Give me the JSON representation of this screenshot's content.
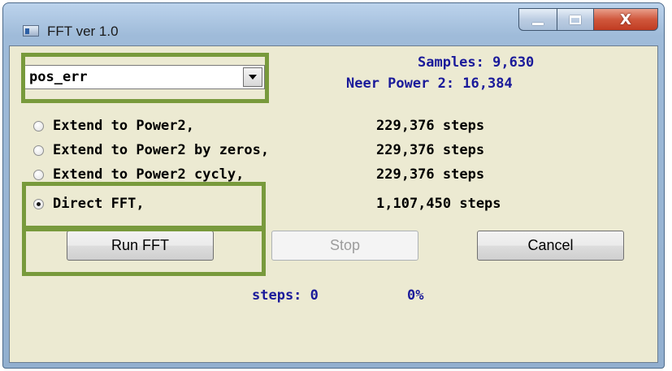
{
  "window": {
    "title": "FFT ver 1.0"
  },
  "title_buttons": {
    "minimize": "minimize",
    "maximize": "maximize",
    "close": "X"
  },
  "signal_select": {
    "value": "pos_err"
  },
  "info": {
    "samples": "Samples: 9,630",
    "near_power2": "Neer Power 2: 16,384"
  },
  "options": [
    {
      "label": "Extend to Power2,",
      "steps": "229,376 steps",
      "checked": false
    },
    {
      "label": "Extend to Power2 by zeros,",
      "steps": "229,376 steps",
      "checked": false
    },
    {
      "label": "Extend to Power2 cycly,",
      "steps": "229,376 steps",
      "checked": false
    },
    {
      "label": "Direct FFT,",
      "steps": "1,107,450 steps",
      "checked": true
    }
  ],
  "buttons": {
    "run": "Run FFT",
    "stop": "Stop",
    "cancel": "Cancel"
  },
  "status": {
    "steps": "steps: 0",
    "percent": "0%"
  },
  "colors": {
    "client_bg": "#ecead2",
    "info_text": "#1a1a9a",
    "highlight": "#789a3c",
    "close_button": "#c03c22"
  }
}
